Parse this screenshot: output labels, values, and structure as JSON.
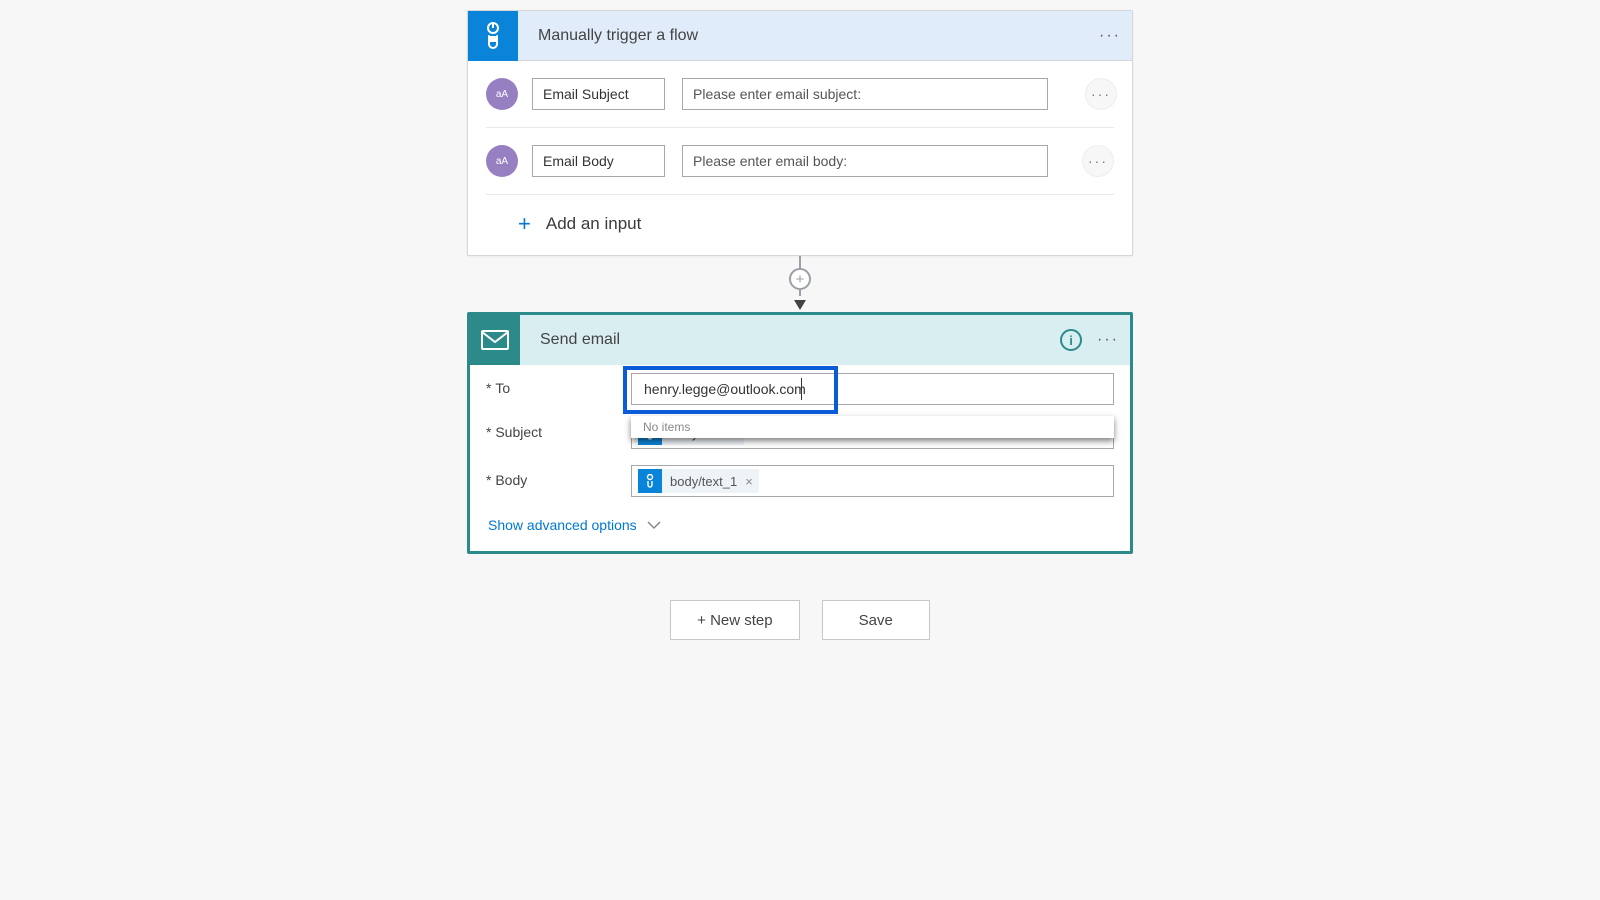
{
  "trigger": {
    "title": "Manually trigger a flow",
    "inputs": [
      {
        "name": "Email Subject",
        "placeholder": "Please enter email subject:",
        "icon_text": "aA"
      },
      {
        "name": "Email Body",
        "placeholder": "Please enter email body:",
        "icon_text": "aA"
      }
    ],
    "add_input_label": "Add an input"
  },
  "send_email": {
    "title": "Send email",
    "to_label": "To",
    "subject_label": "Subject",
    "body_label": "Body",
    "to_value": "henry.legge@outlook.com",
    "suggestion": "No items",
    "subject_token": "body/text",
    "body_token": "body/text_1",
    "advanced_label": "Show advanced options"
  },
  "footer": {
    "new_step": "+ New step",
    "save": "Save"
  }
}
